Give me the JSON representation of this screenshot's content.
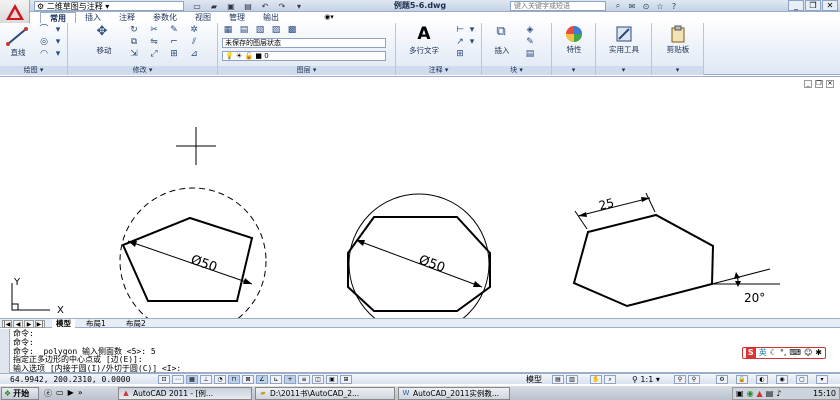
{
  "titlebar": {
    "workspace": "二维草图与注释",
    "doc_title": "例题5-6.dwg",
    "search_placeholder": "键入关键字或短语"
  },
  "ribbon_tabs": [
    "常用",
    "插入",
    "注释",
    "参数化",
    "视图",
    "管理",
    "输出"
  ],
  "panels": {
    "draw": {
      "label": "绘图",
      "big_button": "直线"
    },
    "modify": {
      "label": "修改",
      "big_button": "移动"
    },
    "layers": {
      "label": "图层",
      "state_combo": "未保存的图层状态",
      "layer_combo": "0"
    },
    "annotation": {
      "label": "注释",
      "big_button": "多行文字"
    },
    "block": {
      "label": "块",
      "big_button": "插入"
    },
    "properties": {
      "big_button": "特性"
    },
    "utilities": {
      "big_button": "实用工具"
    },
    "clipboard": {
      "big_button": "剪贴板"
    }
  },
  "drawing": {
    "dims": {
      "circumscribed_diameter": "Ø50",
      "inscribed_diameter": "Ø50",
      "side_length": "25",
      "angle": "20°"
    },
    "ucs": {
      "x_label": "X",
      "y_label": "Y"
    }
  },
  "layout_tabs": [
    "模型",
    "布局1",
    "布局2"
  ],
  "command_window": {
    "lines": [
      "命令:",
      "命令:",
      "命令: _polygon 输入侧面数 <5>: 5",
      "指定正多边形的中心点或 [边(E)]:",
      "输入选项 [内接于圆(I)/外切于圆(C)] <I>:"
    ]
  },
  "ime": {
    "label": "英"
  },
  "statusbar": {
    "coords": "64.9942, 200.2310, 0.0000",
    "mode": "模型",
    "scale": "1:1"
  },
  "taskbar": {
    "start": "开始",
    "buttons": [
      "AutoCAD 2011 - [例...",
      "D:\\2011书\\AutoCAD_2...",
      "AutoCAD_2011实例教..."
    ],
    "clock": "15:10"
  }
}
